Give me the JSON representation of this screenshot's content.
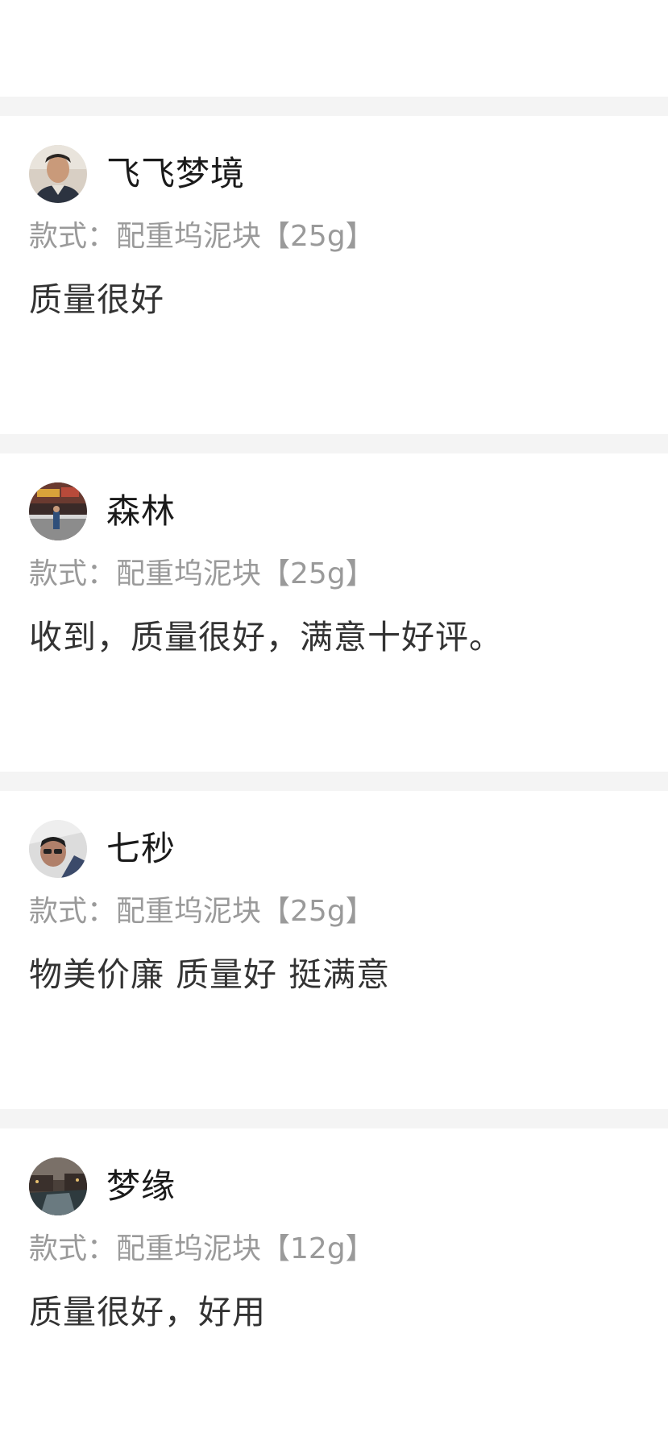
{
  "reviews": [
    {
      "avatar_icon": "user-avatar-icon",
      "username": "飞飞梦境",
      "style_label": "款式：",
      "style_value": "配重坞泥块【25g】",
      "text": "质量很好"
    },
    {
      "avatar_icon": "user-avatar-icon",
      "username": "森林",
      "style_label": "款式：",
      "style_value": "配重坞泥块【25g】",
      "text": "收到，质量很好，满意十好评。"
    },
    {
      "avatar_icon": "user-avatar-icon",
      "username": "七秒",
      "style_label": "款式：",
      "style_value": "配重坞泥块【25g】",
      "text": "物美价廉 质量好 挺满意"
    },
    {
      "avatar_icon": "user-avatar-icon",
      "username": "梦缘",
      "style_label": "款式：",
      "style_value": "配重坞泥块【12g】",
      "text": "质量很好，好用"
    }
  ],
  "colors": {
    "background": "#ffffff",
    "divider": "#f4f4f4",
    "username": "#1a1a1a",
    "style_text": "#9a9a9a",
    "review_text": "#333333"
  }
}
